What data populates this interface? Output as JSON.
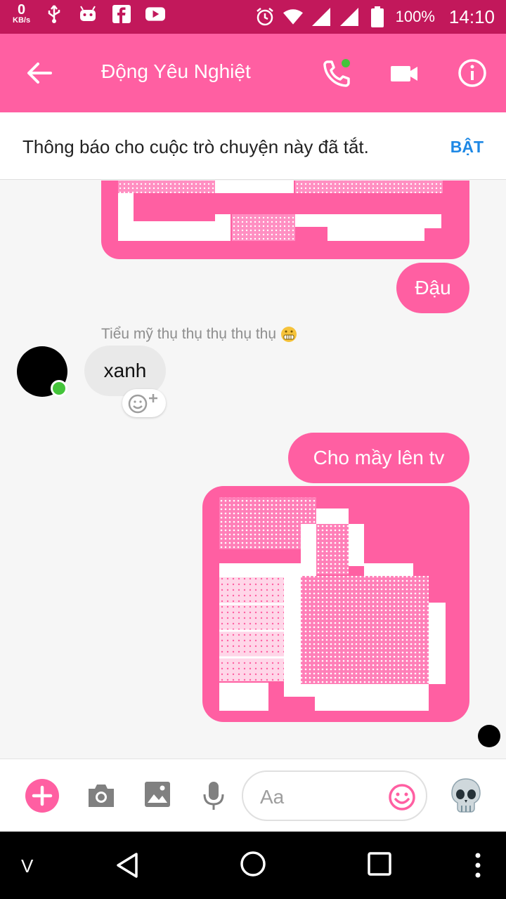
{
  "status_bar": {
    "net_speed_value": "0",
    "net_speed_unit": "KB/s",
    "battery_percent": "100%",
    "time": "14:10"
  },
  "app_bar": {
    "title": "Động Yêu Nghiệt",
    "back_icon": "arrow-back-icon",
    "call_icon": "phone-icon",
    "video_icon": "video-camera-icon",
    "info_icon": "info-icon"
  },
  "banner": {
    "text": "Thông báo cho cuộc trò chuyện này đã tắt.",
    "action_label": "BẬT"
  },
  "messages": [
    {
      "direction": "outgoing",
      "text": "Đậu"
    },
    {
      "direction": "incoming",
      "sender": "Tiểu mỹ thụ thụ thụ thụ thụ",
      "text": "xanh"
    },
    {
      "direction": "outgoing",
      "text": "Cho mầy lên tv"
    }
  ],
  "composer": {
    "placeholder": "Aa",
    "plus_icon": "plus-icon",
    "camera_icon": "camera-icon",
    "image_icon": "image-icon",
    "mic_icon": "microphone-icon",
    "emoji_icon": "smiley-icon",
    "skull_icon": "skull-icon"
  },
  "nav_bar": {
    "left_label": "V"
  },
  "colors": {
    "accent": "#ff5fa2",
    "status_bar": "#c2185b",
    "link": "#1e88e5",
    "online": "#44c43a"
  }
}
